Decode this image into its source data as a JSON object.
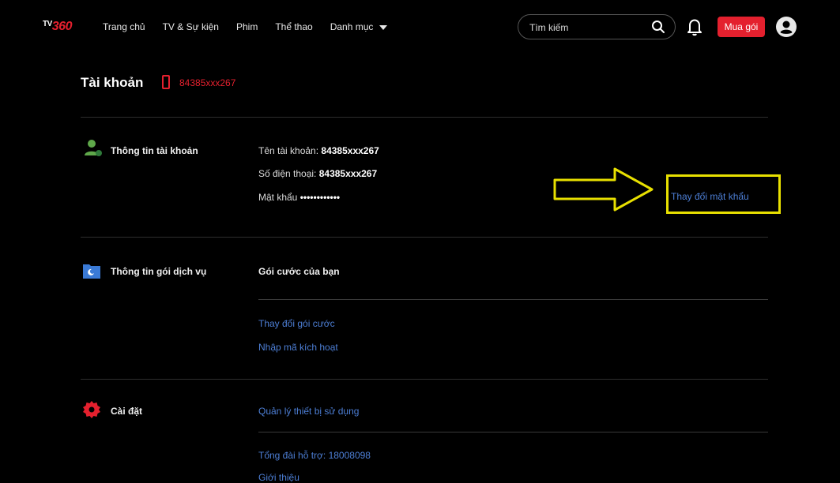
{
  "header": {
    "logo_tv": "TV",
    "logo_num": "360",
    "nav": [
      "Trang chủ",
      "TV & Sự kiện",
      "Phim",
      "Thể thao",
      "Danh mục"
    ],
    "search_placeholder": "Tìm kiếm",
    "buy_label": "Mua gói"
  },
  "account": {
    "title": "Tài khoản",
    "phone": "84385xxx267"
  },
  "account_info": {
    "label": "Thông tin tài khoản",
    "username_label": "Tên tài khoản:",
    "username_value": "84385xxx267",
    "phone_label": "Số điện thoại:",
    "phone_value": "84385xxx267",
    "password_label": "Mật khẩu",
    "password_value": "••••••••••••",
    "change_password": "Thay đổi mật khẩu"
  },
  "service_info": {
    "label": "Thông tin gói dịch vụ",
    "your_plan": "Gói cước của bạn",
    "change_plan": "Thay đổi gói cước",
    "activation_code": "Nhập mã kích hoạt"
  },
  "settings": {
    "label": "Cài đặt",
    "manage_devices": "Quản lý thiết bị sử dụng",
    "hotline": "Tổng đài hỗ trợ: 18008098",
    "about": "Giới thiệu"
  },
  "colors": {
    "accent": "#e4202e",
    "link": "#4d7fd6",
    "highlight": "#e8e000"
  }
}
